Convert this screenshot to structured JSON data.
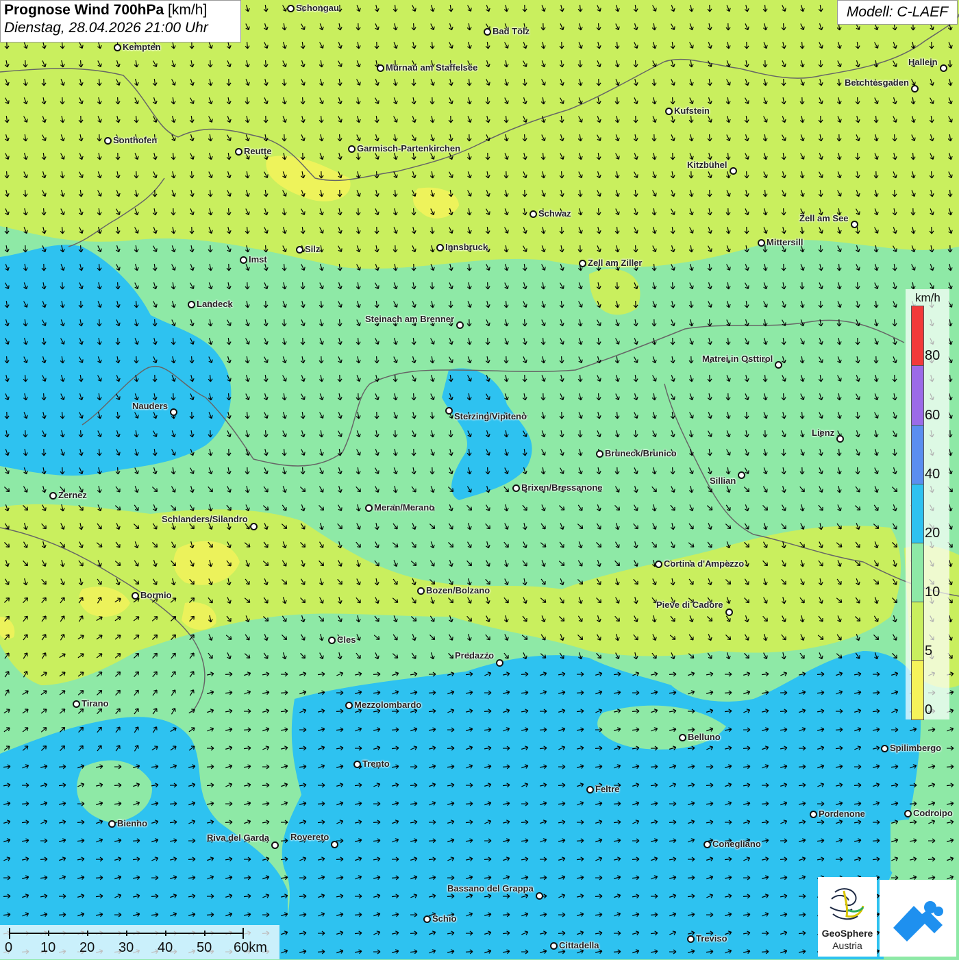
{
  "title": {
    "main_bold": "Prognose Wind 700hPa",
    "main_unit": " [km/h]",
    "subtitle": "Dienstag, 28.04.2026 21:00 Uhr"
  },
  "model": "Modell: C-LAEF",
  "legend": {
    "unit": "km/h",
    "ticks": [
      "80",
      "60",
      "40",
      "20",
      "10",
      "5",
      "0"
    ],
    "colors": [
      "#f23a3a",
      "#9b6be8",
      "#5a8ef0",
      "#2ec2f0",
      "#8ee9a6",
      "#c9ef5e",
      "#f5f35a"
    ]
  },
  "scale": {
    "labels": [
      "0",
      "10",
      "20",
      "30",
      "40",
      "50",
      "60km"
    ]
  },
  "logo": {
    "brand_line1": "GeoSphere",
    "brand_line2": "Austria",
    "icon": "geosphere-logo-icon",
    "app_icon": "app-arrow-icon"
  },
  "colors": {
    "calm": "#f5f35a",
    "light": "#c9ef5e",
    "moderate": "#8ee9a6",
    "fresh": "#2ec2f0",
    "strong": "#5a8ef0"
  },
  "cities": [
    {
      "name": "Schongau"
    },
    {
      "name": "Bad Tölz"
    },
    {
      "name": "Kempten"
    },
    {
      "name": "Murnau am Staffelsee"
    },
    {
      "name": "Hallein"
    },
    {
      "name": "Berchtesgaden"
    },
    {
      "name": "Kufstein"
    },
    {
      "name": "Sonthofen"
    },
    {
      "name": "Reutte"
    },
    {
      "name": "Garmisch-Partenkirchen"
    },
    {
      "name": "Kitzbühel"
    },
    {
      "name": "Schwaz"
    },
    {
      "name": "Zell am See"
    },
    {
      "name": "Silz"
    },
    {
      "name": "Innsbruck"
    },
    {
      "name": "Mittersill"
    },
    {
      "name": "Imst"
    },
    {
      "name": "Zell am Ziller"
    },
    {
      "name": "Landeck"
    },
    {
      "name": "Steinach am Brenner"
    },
    {
      "name": "Matrei in Osttirol"
    },
    {
      "name": "Nauders"
    },
    {
      "name": "Sterzing/Vipiteno"
    },
    {
      "name": "Lienz"
    },
    {
      "name": "Bruneck/Brunico"
    },
    {
      "name": "Sillian"
    },
    {
      "name": "Zernez"
    },
    {
      "name": "Brixen/Bressanone"
    },
    {
      "name": "Meran/Merano"
    },
    {
      "name": "Schlanders/Silandro"
    },
    {
      "name": "Cortina d'Ampezzo"
    },
    {
      "name": "Bozen/Bolzano"
    },
    {
      "name": "Bormio"
    },
    {
      "name": "Pieve di Cadore"
    },
    {
      "name": "Cles"
    },
    {
      "name": "Predazzo"
    },
    {
      "name": "Tirano"
    },
    {
      "name": "Mezzolombardo"
    },
    {
      "name": "Belluno"
    },
    {
      "name": "Spilimbergo"
    },
    {
      "name": "Trento"
    },
    {
      "name": "Feltre"
    },
    {
      "name": "Pordenone"
    },
    {
      "name": "Codroipo"
    },
    {
      "name": "Bienno"
    },
    {
      "name": "Riva del Garda"
    },
    {
      "name": "Rovereto"
    },
    {
      "name": "Conegliano"
    },
    {
      "name": "Bassano del Grappa"
    },
    {
      "name": "Schio"
    },
    {
      "name": "Cittadella"
    },
    {
      "name": "Treviso"
    }
  ]
}
